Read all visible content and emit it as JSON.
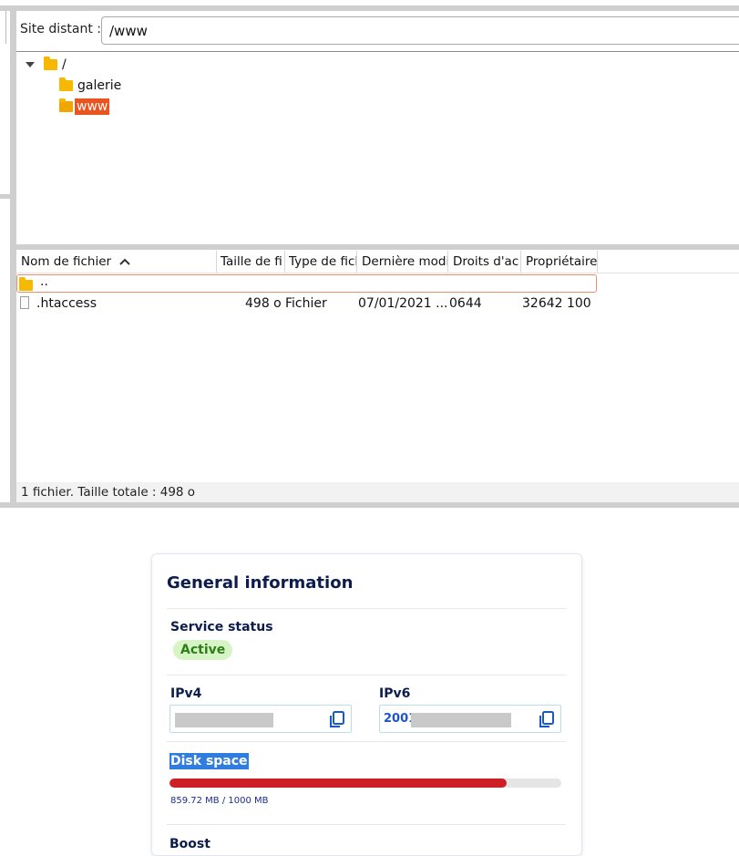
{
  "remote": {
    "label": "Site distant :",
    "path": "/www"
  },
  "tree": {
    "root": "/",
    "children": [
      "galerie",
      "www"
    ],
    "selected": "www"
  },
  "filelist": {
    "columns": [
      "Nom de fichier",
      "Taille de fi",
      "Type de ficl",
      "Dernière modi",
      "Droits d'ac",
      "Propriétaire"
    ],
    "sort_column": "Nom de fichier",
    "parent_entry": "..",
    "rows": [
      {
        "name": ".htaccess",
        "size": "498 o",
        "type": "Fichier",
        "modified": "07/01/2021 ...",
        "perms": "0644",
        "owner": "32642 100"
      }
    ],
    "status": "1 fichier. Taille totale : 498 o"
  },
  "card": {
    "title": "General information",
    "service_status_label": "Service status",
    "service_status_value": "Active",
    "ipv4_label": "IPv4",
    "ipv6_label": "IPv6",
    "ipv6_prefix": "2001",
    "disk_label": "Disk space",
    "disk_used_fraction": 0.8597,
    "disk_text": "859.72 MB / 1000 MB",
    "boost_label": "Boost"
  },
  "colors": {
    "selection": "#e95420",
    "folder": "#f6b800",
    "progress": "#cc1f26",
    "title": "#0b1c4d",
    "badge_bg": "#d6f4c6",
    "badge_fg": "#2e7d16"
  },
  "icons": [
    "folder-icon",
    "expand-triangle-icon",
    "sort-ascending-icon",
    "file-icon",
    "copy-icon"
  ]
}
